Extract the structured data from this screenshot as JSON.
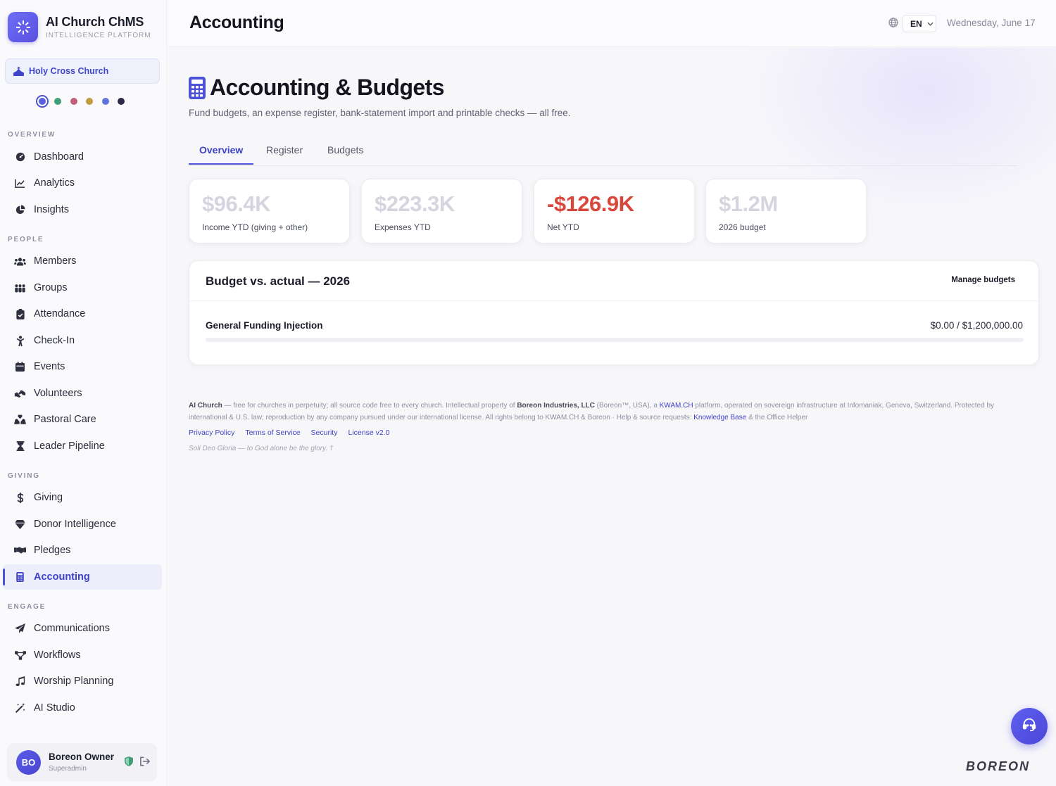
{
  "brand": {
    "title": "AI Church ChMS",
    "subtitle": "INTELLIGENCE PLATFORM"
  },
  "church": {
    "name": "Holy Cross Church"
  },
  "theme_dots": [
    "#5b5fe0",
    "#3f9e78",
    "#c0607a",
    "#c29a3f",
    "#5f75dd",
    "#2a2c45"
  ],
  "nav": {
    "sections": [
      {
        "label": "OVERVIEW"
      },
      {
        "label": "PEOPLE"
      },
      {
        "label": "GIVING"
      },
      {
        "label": "ENGAGE"
      }
    ],
    "items": [
      {
        "label": "Dashboard",
        "icon": "dashboard-icon"
      },
      {
        "label": "Analytics",
        "icon": "chart-line-icon"
      },
      {
        "label": "Insights",
        "icon": "pie-chart-icon"
      },
      {
        "label": "Members",
        "icon": "users-icon"
      },
      {
        "label": "Groups",
        "icon": "people-group-icon"
      },
      {
        "label": "Attendance",
        "icon": "clipboard-check-icon"
      },
      {
        "label": "Check-In",
        "icon": "child-icon"
      },
      {
        "label": "Events",
        "icon": "calendar-icon"
      },
      {
        "label": "Volunteers",
        "icon": "hands-helping-icon"
      },
      {
        "label": "Pastoral Care",
        "icon": "hands-heart-icon"
      },
      {
        "label": "Leader Pipeline",
        "icon": "hourglass-icon"
      },
      {
        "label": "Giving",
        "icon": "dollar-icon"
      },
      {
        "label": "Donor Intelligence",
        "icon": "gem-icon"
      },
      {
        "label": "Pledges",
        "icon": "handshake-icon"
      },
      {
        "label": "Accounting",
        "icon": "calculator-icon"
      },
      {
        "label": "Communications",
        "icon": "paper-plane-icon"
      },
      {
        "label": "Workflows",
        "icon": "workflow-icon"
      },
      {
        "label": "Worship Planning",
        "icon": "music-icon"
      },
      {
        "label": "AI Studio",
        "icon": "magic-wand-icon"
      }
    ]
  },
  "user": {
    "initials": "BO",
    "name": "Boreon Owner",
    "role": "Superadmin"
  },
  "topbar": {
    "title": "Accounting",
    "language": "EN",
    "date": "Wednesday, June 17"
  },
  "hero": {
    "title": "Accounting & Budgets",
    "subtitle": "Fund budgets, an expense register, bank-statement import and printable checks — all free."
  },
  "tabs": [
    {
      "label": "Overview"
    },
    {
      "label": "Register"
    },
    {
      "label": "Budgets"
    }
  ],
  "stats": [
    {
      "value": "$96.4K",
      "label": "Income YTD (giving + other)"
    },
    {
      "value": "$223.3K",
      "label": "Expenses YTD"
    },
    {
      "value": "-$126.9K",
      "label": "Net YTD"
    },
    {
      "value": "$1.2M",
      "label": "2026 budget"
    }
  ],
  "budget_card": {
    "title": "Budget vs. actual — 2026",
    "action": "Manage budgets",
    "rows": [
      {
        "name": "General Funding Injection",
        "amount": "$0.00 / $1,200,000.00",
        "progress": 0
      }
    ]
  },
  "footer": {
    "brand": "AI Church",
    "text1": " — free for churches in perpetuity; all source code free to every church. Intellectual property of ",
    "company": "Boreon Industries, LLC",
    "text2": " (Boreon™, USA), a ",
    "kwam": "KWAM.CH",
    "text3": " platform, operated on sovereign infrastructure at Infomaniak, Geneva, Switzerland. Protected by international & U.S. law; reproduction by any company pursued under our international license. All rights belong to KWAM.CH & Boreon · Help & source requests: ",
    "kb": "Knowledge Base",
    "text4": " & the Office Helper",
    "links": [
      "Privacy Policy",
      "Terms of Service",
      "Security",
      "License v2.0"
    ],
    "motto": "Soli Deo Gloria — to God alone be the glory. †"
  },
  "watermark": "BOREON",
  "colors": {
    "accent": "#4e52d6",
    "negative": "#d9463a"
  }
}
